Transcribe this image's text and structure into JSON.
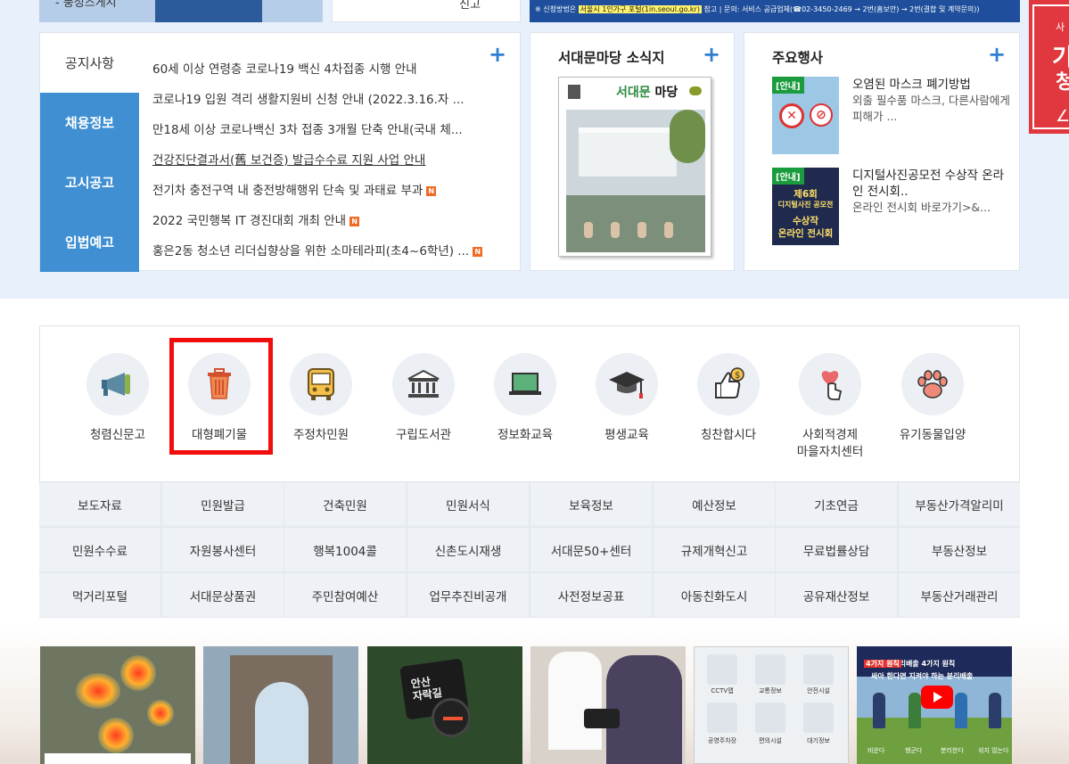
{
  "top_strip": {
    "left_text": "- 풍성즈게시",
    "mid_text": "신고",
    "right_prefix": "※ 신청방법은",
    "right_highlight": "서울시 1인가구 포털(1in.seoul.go.kr)",
    "right_suffix": "참고 | 문의: 서비스 공급업체(☎02-3450-2469 → 2번(홈보안) → 2번(결합 및 계약문의))"
  },
  "side_banner": {
    "line1": "사",
    "line2": "기",
    "line3": "청"
  },
  "notice": {
    "tabs": [
      "공지사항",
      "채용정보",
      "고시공고",
      "입법예고"
    ],
    "items": [
      {
        "text": "60세 이상 연령층 코로나19 백신 4차접종 시행 안내",
        "new": ""
      },
      {
        "text": "코로나19 입원 격리 생활지원비 신청 안내 (2022.3.16.자 ...",
        "new": ""
      },
      {
        "text": "만18세 이상 코로나백신 3차 접종 3개월 단축 안내(국내 체...",
        "new": ""
      },
      {
        "text": "건강진단결과서(舊 보건증) 발급수수료 지원 사업 안내",
        "new": ""
      },
      {
        "text": "전기차 충전구역 내 충전방해행위 단속 및 과태료 부과",
        "new": "N"
      },
      {
        "text": "2022 국민행복 IT 경진대회 개최 안내",
        "new": "N"
      },
      {
        "text": "홍은2동 청소년 리더십향상을 위한 소마테라피(초4~6학년) ...",
        "new": "N"
      }
    ],
    "plus": "+"
  },
  "magazine": {
    "title": "서대문마당 소식지",
    "plus": "+",
    "cover_title_a": "서대문 ",
    "cover_title_b": "마당"
  },
  "events": {
    "title": "주요행사",
    "plus": "+",
    "items": [
      {
        "badge": "[안내]",
        "title": "오염된 마스크 폐기방법",
        "desc": "외출 필수품 마스크, 다른사람에게 피해가 ..."
      },
      {
        "badge": "[안내]",
        "title": "디지털사진공모전 수상작 온라인 전시회..",
        "desc": "온라인 전시회 바로가기>&...",
        "thumb_lines": [
          "제6회",
          "디지털사진 공모전",
          "수상작",
          "온라인 전시회"
        ]
      }
    ]
  },
  "quick_menu": [
    {
      "label": "청렴신문고",
      "icon": "megaphone-icon"
    },
    {
      "label": "대형폐기물",
      "icon": "trash-can-icon"
    },
    {
      "label": "주정차민원",
      "icon": "bus-icon"
    },
    {
      "label": "구립도서관",
      "icon": "library-building-icon"
    },
    {
      "label": "정보화교육",
      "icon": "laptop-icon"
    },
    {
      "label": "평생교육",
      "icon": "graduation-cap-icon"
    },
    {
      "label": "칭찬합시다",
      "icon": "thumbs-up-icon"
    },
    {
      "label": "사회적경제\n마을자치센터",
      "icon": "heart-hand-icon"
    },
    {
      "label": "유기동물입양",
      "icon": "paw-icon"
    }
  ],
  "link_grid": [
    [
      "보도자료",
      "민원발급",
      "건축민원",
      "민원서식",
      "보육정보",
      "예산정보",
      "기초연금",
      "부동산가격알리미"
    ],
    [
      "민원수수료",
      "자원봉사센터",
      "행복1004콜",
      "신촌도시재생",
      "서대문50+센터",
      "규제개혁신고",
      "무료법률상담",
      "부동산정보"
    ],
    [
      "먹거리포털",
      "서대문상품권",
      "주민참여예산",
      "업무추진비공개",
      "사전정보공표",
      "아동친화도시",
      "공유재산정보",
      "부동산거래관리"
    ]
  ],
  "thumbs": {
    "p3_sign": "안산\n자락길",
    "p5_tiles": [
      "CCTV맵",
      "교통정보",
      "안전시설",
      "공영주차장",
      "편의시설",
      "대기정보"
    ],
    "p6_banner_a": "싸아 한다면 지켜야 하는 분리배출",
    "p6_banner_b": "4가지 원칙",
    "p6_captions": [
      "비운다",
      "헹군다",
      "분리한다",
      "섞지 않는다"
    ],
    "p6_channel": "서대문구 분리배출 4가지 원칙"
  },
  "colors": {
    "tab_blue": "#3f8fd2",
    "accent": "#2f7fd0",
    "highlight": "#f20c0c",
    "new_badge": "#f06a24",
    "event_badge": "#1a9b3c"
  }
}
